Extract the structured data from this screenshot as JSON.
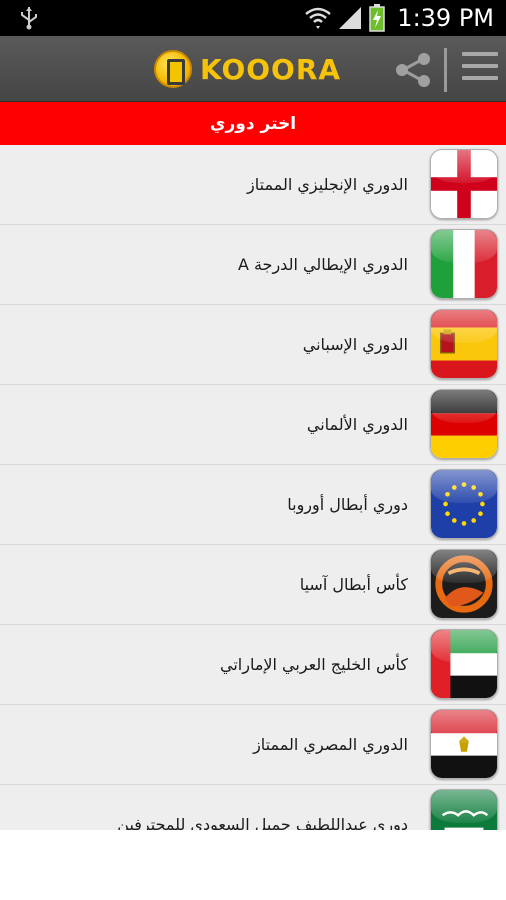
{
  "status_bar": {
    "time": "1:39 PM",
    "icons": [
      "usb-icon",
      "wifi-icon",
      "signal-icon",
      "battery-charging-icon"
    ]
  },
  "app_bar": {
    "logo_text": "KOOORA",
    "icons": [
      "share-icon",
      "menu-icon"
    ]
  },
  "header": {
    "title": "اختر دوري"
  },
  "leagues": [
    {
      "label": "الدوري الإنجليزي الممتاز",
      "icon": "england-flag-icon"
    },
    {
      "label": "الدوري الإيطالي الدرجة A",
      "icon": "italy-flag-icon"
    },
    {
      "label": "الدوري الإسباني",
      "icon": "spain-flag-icon"
    },
    {
      "label": "الدوري الألماني",
      "icon": "germany-flag-icon"
    },
    {
      "label": "دوري أبطال أوروبا",
      "icon": "europe-flag-icon"
    },
    {
      "label": "كأس أبطال آسيا",
      "icon": "asia-champions-icon"
    },
    {
      "label": "كأس الخليج العربي الإماراتي",
      "icon": "uae-flag-icon"
    },
    {
      "label": "الدوري المصري الممتاز",
      "icon": "egypt-flag-icon"
    },
    {
      "label": "دوري عبداللطيف جميل السعودي للمحترفين",
      "icon": "saudi-flag-icon"
    }
  ],
  "colors": {
    "header_red": "#ff0000",
    "logo_gold": "#f7c20a",
    "app_bar_gray": "#4e4e4e",
    "list_bg": "#eeeeee"
  }
}
